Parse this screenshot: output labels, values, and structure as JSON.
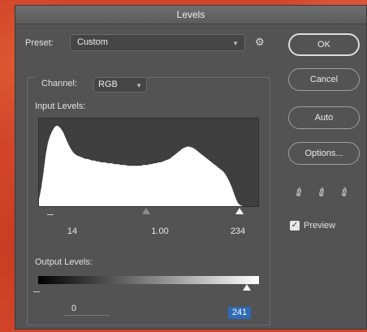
{
  "window": {
    "title": "Levels"
  },
  "preset": {
    "label": "Preset:",
    "value": "Custom"
  },
  "channel": {
    "label": "Channel:",
    "value": "RGB"
  },
  "input_levels": {
    "label": "Input Levels:",
    "black": "14",
    "gamma": "1.00",
    "white": "234",
    "histogram": [
      8,
      20,
      38,
      58,
      72,
      80,
      86,
      90,
      92,
      91,
      88,
      84,
      78,
      72,
      67,
      63,
      60,
      58,
      57,
      56,
      55,
      54,
      54,
      53,
      52,
      52,
      51,
      51,
      50,
      50,
      50,
      49,
      49,
      49,
      48,
      48,
      48,
      47,
      47,
      47,
      46,
      46,
      46,
      46,
      46,
      46,
      46,
      47,
      47,
      47,
      48,
      48,
      49,
      49,
      50,
      50,
      51,
      52,
      53,
      54,
      56,
      58,
      60,
      62,
      64,
      66,
      67,
      68,
      68,
      67,
      66,
      64,
      62,
      60,
      58,
      56,
      54,
      52,
      50,
      48,
      46,
      44,
      42,
      40,
      37,
      33,
      28,
      22,
      15,
      8,
      3,
      1,
      0,
      0,
      0,
      0,
      0,
      0,
      0,
      0
    ]
  },
  "output_levels": {
    "label": "Output Levels:",
    "low": "0",
    "high": "241"
  },
  "buttons": {
    "ok": "OK",
    "cancel": "Cancel",
    "auto": "Auto",
    "options": "Options..."
  },
  "preview": {
    "label": "Preview",
    "checked": true
  },
  "icons": {
    "gear": "gear-icon",
    "eyedroppers": [
      "black-point-eyedropper-icon",
      "gray-point-eyedropper-icon",
      "white-point-eyedropper-icon"
    ]
  },
  "colors": {
    "background": "#d2452a",
    "panel": "#535353",
    "histogram_fill": "#ffffff",
    "histogram_bg": "#3f3f3f",
    "selection": "#2f69b7"
  }
}
